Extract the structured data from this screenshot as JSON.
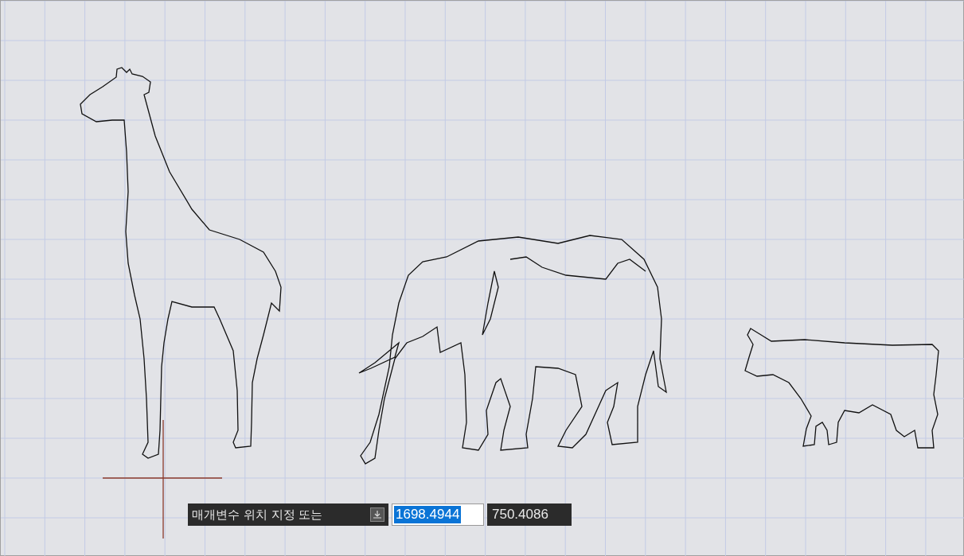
{
  "prompt": {
    "label": "매개변수 위치 지정 또는",
    "fields": [
      {
        "value": "1698.4944",
        "text_selected": true
      },
      {
        "value": "750.4086",
        "text_selected": false
      }
    ]
  }
}
